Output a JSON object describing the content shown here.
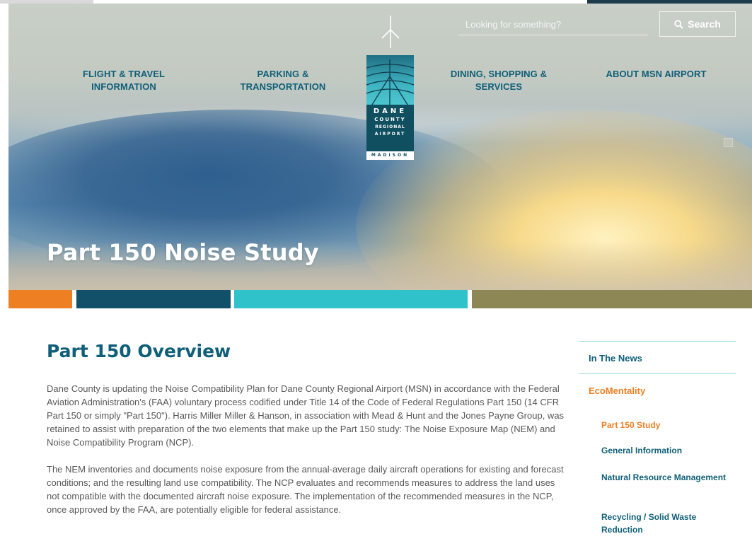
{
  "search": {
    "placeholder": "Looking for something?",
    "button_label": "Search"
  },
  "nav": {
    "flight_line1": "FLIGHT & TRAVEL",
    "flight_line2": "INFORMATION",
    "parking_line1": "PARKING &",
    "parking_line2": "TRANSPORTATION",
    "dining_line1": "DINING, SHOPPING &",
    "dining_line2": "SERVICES",
    "about": "ABOUT MSN AIRPORT"
  },
  "logo": {
    "line1": "DANE",
    "line2": "COUNTY",
    "line3": "REGIONAL",
    "line4": "AIRPORT",
    "line5": "MADISON"
  },
  "hero": {
    "title": "Part 150 Noise Study"
  },
  "main": {
    "title": "Part 150 Overview",
    "para1": "Dane County is updating the Noise Compatibility Plan for Dane County Regional Airport (MSN) in accordance with the Federal Aviation Administration's (FAA) voluntary process codified under Title 14 of the Code of Federal Regulations Part 150 (14 CFR Part 150 or simply \"Part 150\"). Harris Miller Miller & Hanson, in association with Mead & Hunt and the Jones Payne Group, was retained to assist with preparation of the two elements that make up the Part 150 study: The Noise Exposure Map (NEM) and Noise Compatibility Program (NCP).",
    "para2": "The NEM inventories and documents noise exposure from the annual-average daily aircraft operations for existing and forecast conditions; and the resulting land use compatibility. The NCP evaluates and recommends measures to address the land uses not compatible with the documented aircraft noise exposure. The implementation of the recommended measures in the NCP, once approved by the FAA, are potentially eligible for federal assistance."
  },
  "sidebar": {
    "in_the_news": "In The News",
    "ecomentality": "EcoMentality",
    "sub_items": [
      "Part 150 Study",
      "General Information",
      "Natural Resource Management",
      "Recycling / Solid Waste Reduction"
    ]
  },
  "colors": {
    "brand_teal": "#0f5f78",
    "accent_orange": "#ee7f22",
    "bar_navy": "#12506a",
    "bar_teal": "#30c2cb",
    "bar_olive": "#8d8756"
  }
}
